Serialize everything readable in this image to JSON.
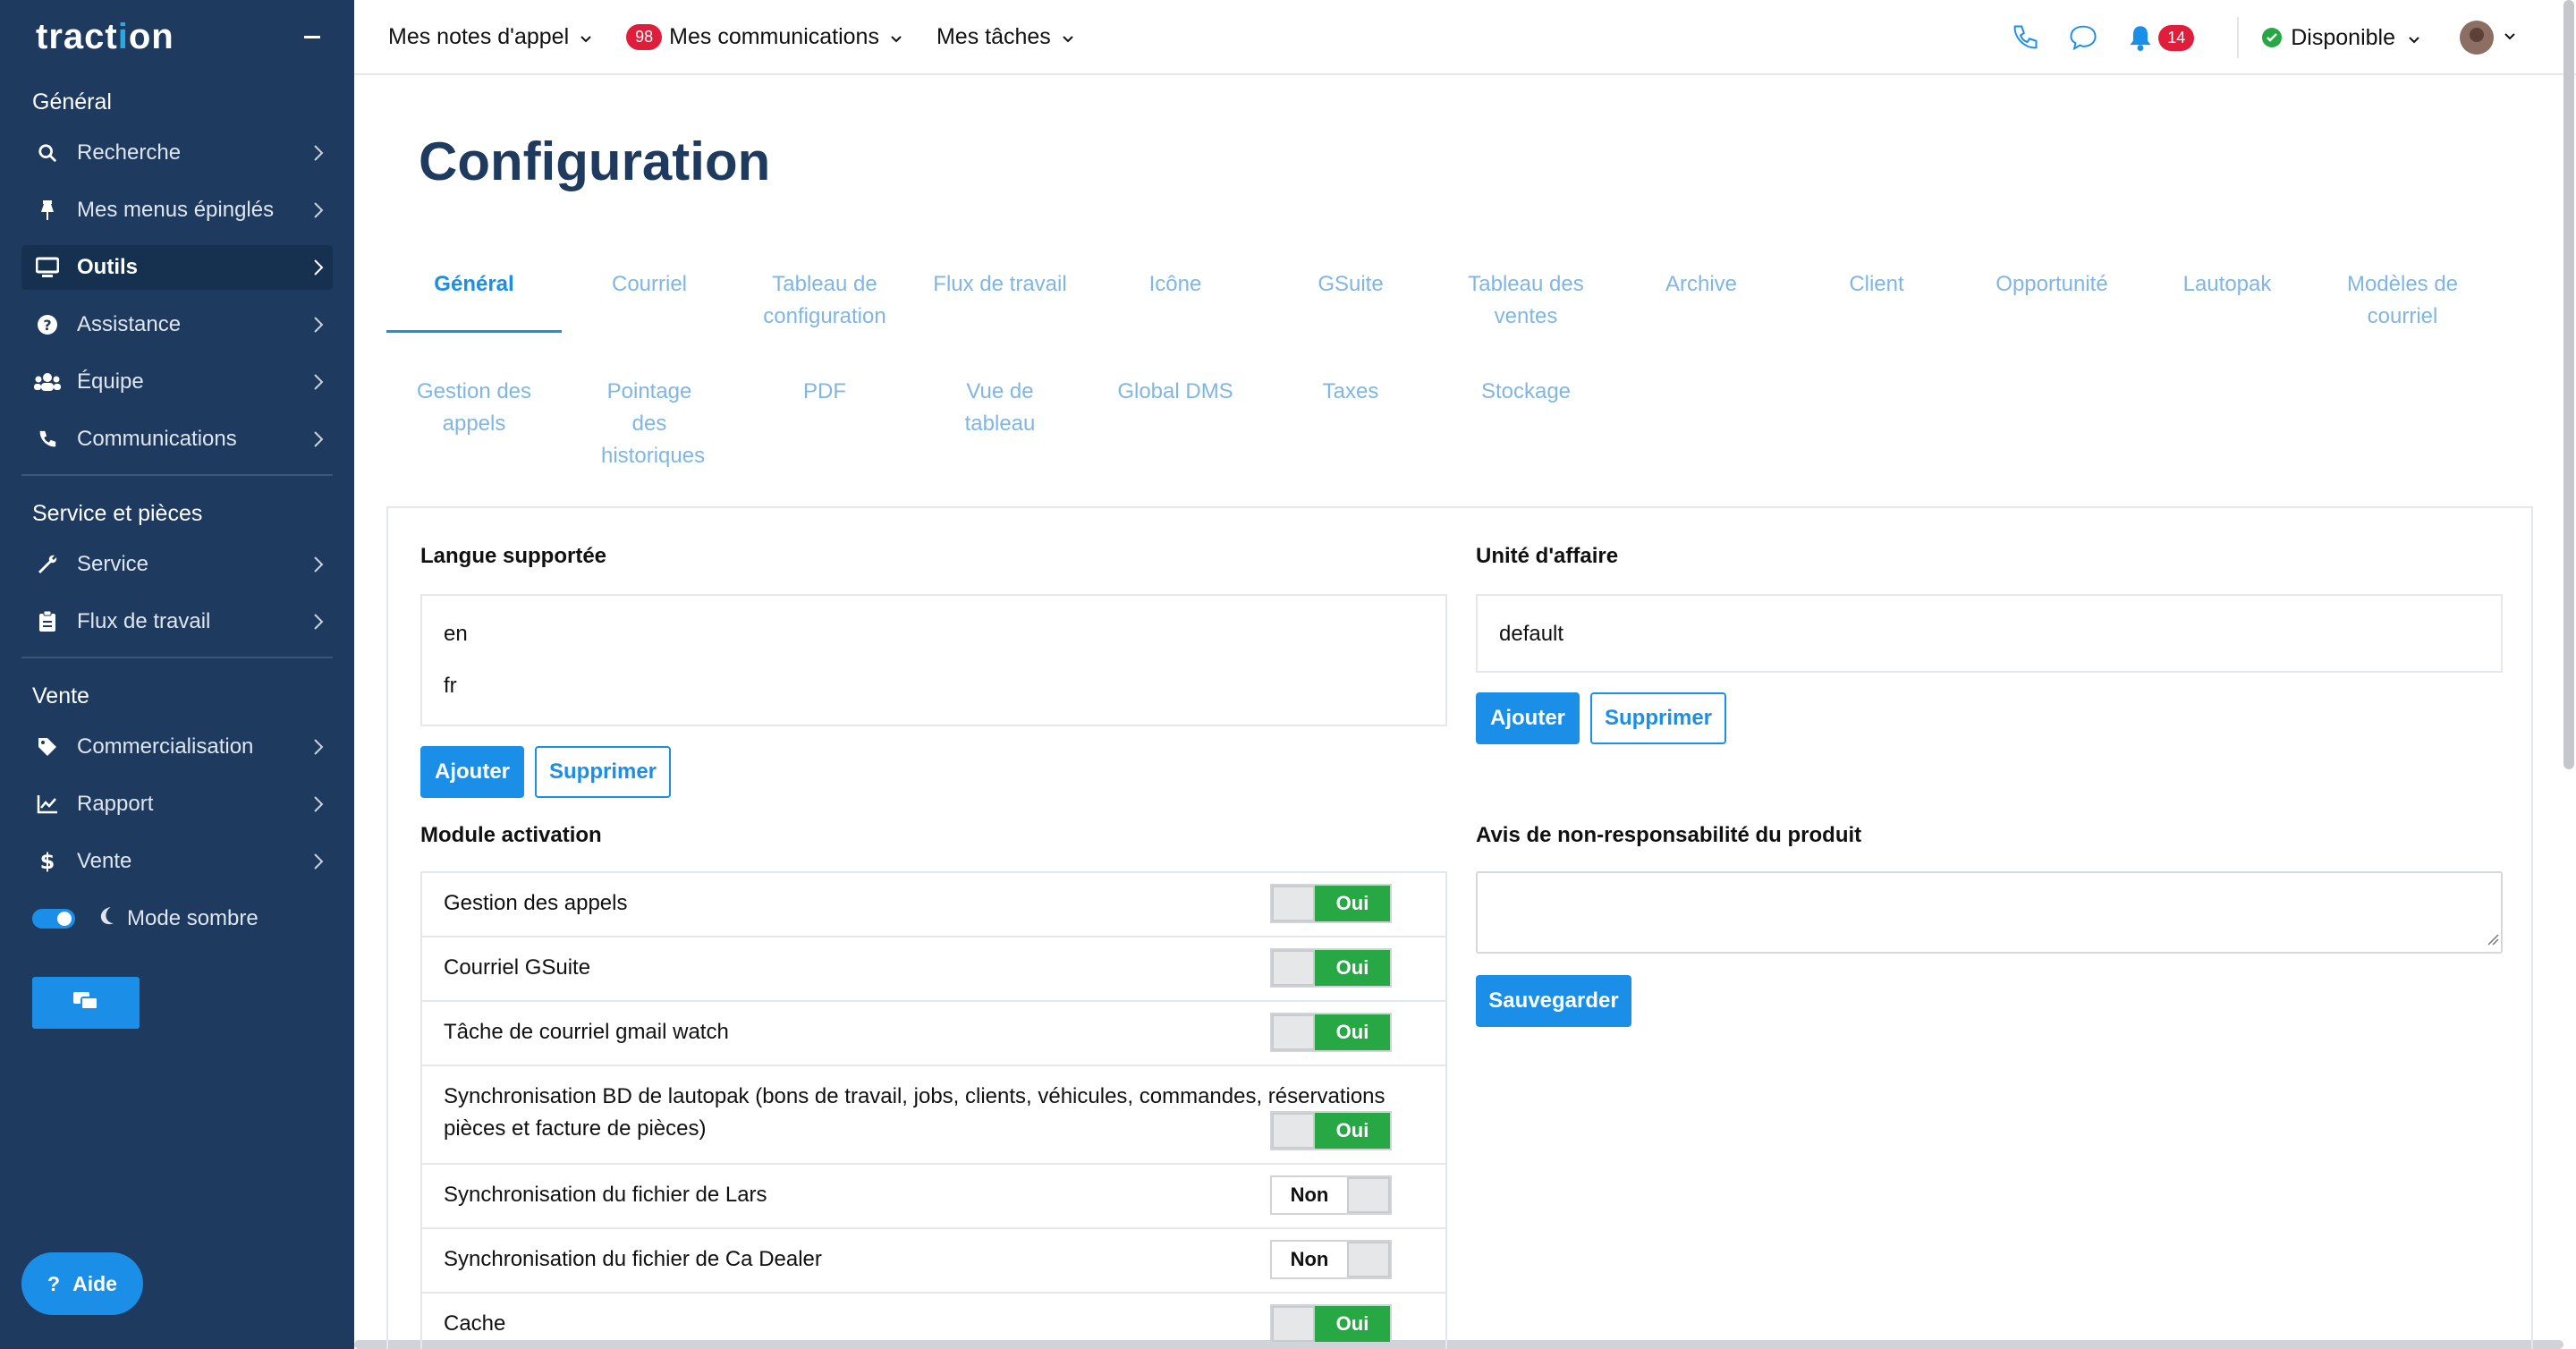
{
  "sidebar": {
    "logo": {
      "before": "tract",
      "dot": "i",
      "after": "on"
    },
    "sections": [
      {
        "title": "Général",
        "items": [
          {
            "label": "Recherche",
            "icon": "search-icon"
          },
          {
            "label": "Mes menus épinglés",
            "icon": "pin-icon"
          },
          {
            "label": "Outils",
            "icon": "monitor-icon",
            "active": true
          },
          {
            "label": "Assistance",
            "icon": "question-circle-icon"
          },
          {
            "label": "Équipe",
            "icon": "users-icon"
          },
          {
            "label": "Communications",
            "icon": "phone-icon"
          }
        ]
      },
      {
        "title": "Service et pièces",
        "items": [
          {
            "label": "Service",
            "icon": "wrench-icon"
          },
          {
            "label": "Flux de travail",
            "icon": "clipboard-icon"
          }
        ]
      },
      {
        "title": "Vente",
        "items": [
          {
            "label": "Commercialisation",
            "icon": "tag-icon"
          },
          {
            "label": "Rapport",
            "icon": "chart-line-icon"
          },
          {
            "label": "Vente",
            "icon": "dollar-icon"
          }
        ]
      }
    ],
    "dark_mode_label": "Mode sombre",
    "help_label": "Aide"
  },
  "topbar": {
    "call_notes": "Mes notes d'appel",
    "communications": "Mes communications",
    "communications_badge": "98",
    "tasks": "Mes tâches",
    "notifications_badge": "14",
    "status": "Disponible"
  },
  "page": {
    "title": "Configuration",
    "tabs_row1": [
      "Général",
      "Courriel",
      "Tableau de configuration",
      "Flux de travail",
      "Icône",
      "GSuite",
      "Tableau des ventes",
      "Archive",
      "Client",
      "Opportunité",
      "Lautopak",
      "Modèles de courriel"
    ],
    "tabs_row2": [
      "Gestion des appels",
      "Pointage des historiques",
      "PDF",
      "Vue de tableau",
      "Global DMS",
      "Taxes",
      "Stockage"
    ]
  },
  "languages": {
    "label": "Langue supportée",
    "values": [
      "en",
      "fr"
    ],
    "add": "Ajouter",
    "remove": "Supprimer"
  },
  "business_unit": {
    "label": "Unité d'affaire",
    "value": "default",
    "add": "Ajouter",
    "remove": "Supprimer"
  },
  "modules": {
    "label": "Module activation",
    "items": [
      {
        "label": "Gestion des appels",
        "state": "Oui",
        "on": true
      },
      {
        "label": "Courriel GSuite",
        "state": "Oui",
        "on": true
      },
      {
        "label": "Tâche de courriel gmail watch",
        "state": "Oui",
        "on": true
      },
      {
        "label": "Synchronisation BD de lautopak (bons de travail, jobs, clients, véhicules, commandes, réservations pièces et facture de pièces)",
        "state": "Oui",
        "on": true
      },
      {
        "label": "Synchronisation du fichier de Lars",
        "state": "Non",
        "on": false
      },
      {
        "label": "Synchronisation du fichier de Ca Dealer",
        "state": "Non",
        "on": false
      },
      {
        "label": "Cache",
        "state": "Oui",
        "on": true
      }
    ]
  },
  "disclaimer": {
    "label": "Avis de non-responsabilité du produit",
    "value": "",
    "save": "Sauvegarder"
  },
  "colors": {
    "sidebar": "#1e3a5f",
    "accent": "#1b8fe8",
    "on": "#28a745",
    "badge": "#e01e3c",
    "tab_inactive": "#7fb6e3"
  }
}
